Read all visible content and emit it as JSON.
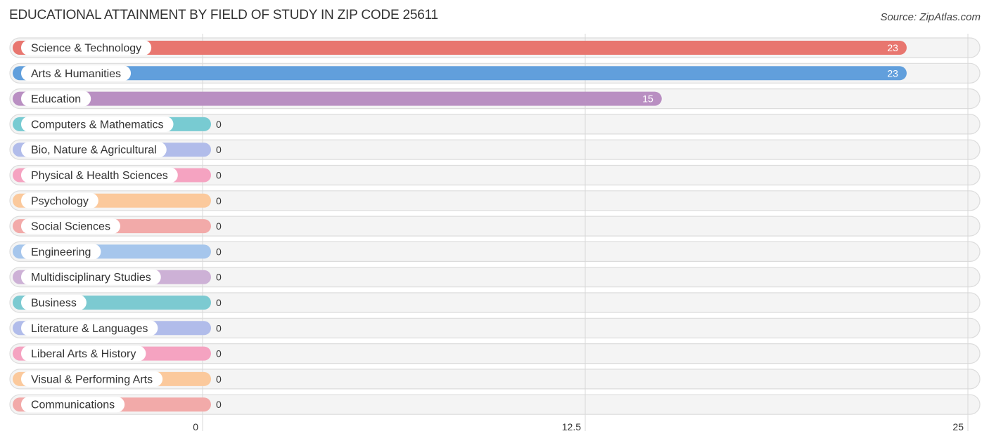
{
  "chart_data": {
    "type": "bar",
    "orientation": "horizontal",
    "title": "EDUCATIONAL ATTAINMENT BY FIELD OF STUDY IN ZIP CODE 25611",
    "source": "Source: ZipAtlas.com",
    "xlabel": "",
    "ylabel": "",
    "xlim": [
      0,
      25
    ],
    "xticks": [
      0,
      12.5,
      25
    ],
    "xtick_labels": [
      "0",
      "12.5",
      "25"
    ],
    "grid": true,
    "categories": [
      "Science & Technology",
      "Arts & Humanities",
      "Education",
      "Computers & Mathematics",
      "Bio, Nature & Agricultural",
      "Physical & Health Sciences",
      "Psychology",
      "Social Sciences",
      "Engineering",
      "Multidisciplinary Studies",
      "Business",
      "Literature & Languages",
      "Liberal Arts & History",
      "Visual & Performing Arts",
      "Communications"
    ],
    "values": [
      23,
      23,
      15,
      0,
      0,
      0,
      0,
      0,
      0,
      0,
      0,
      0,
      0,
      0,
      0
    ],
    "value_labels": [
      "23",
      "23",
      "15",
      "0",
      "0",
      "0",
      "0",
      "0",
      "0",
      "0",
      "0",
      "0",
      "0",
      "0",
      "0"
    ],
    "colors": [
      "#e8766f",
      "#619fdc",
      "#b98fc2",
      "#78cbd2",
      "#b1bcea",
      "#f5a3c1",
      "#fbc99c",
      "#f2aaa9",
      "#a6c6ec",
      "#cdb1d6",
      "#7ccad1",
      "#b1bcea",
      "#f5a3c1",
      "#fbc99c",
      "#f2aaa9"
    ]
  }
}
